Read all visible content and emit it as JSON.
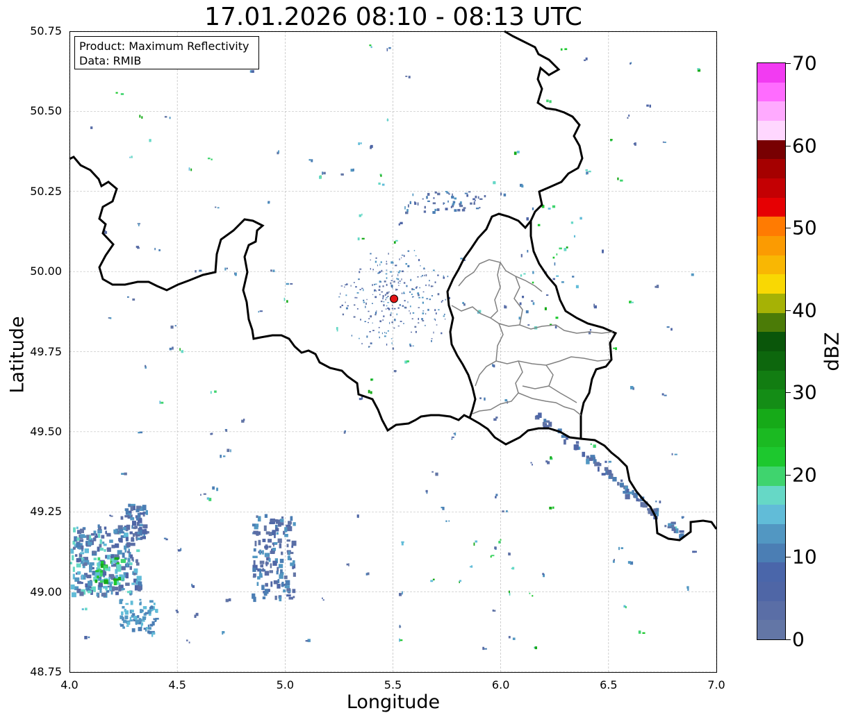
{
  "title": "17.01.2026 08:10 - 08:13 UTC",
  "info": {
    "product": "Product: Maximum Reflectivity",
    "data": "Data: RMIB"
  },
  "axes": {
    "xlabel": "Longitude",
    "ylabel": "Latitude",
    "xlim": [
      4.0,
      7.0
    ],
    "ylim": [
      48.75,
      50.75
    ],
    "x_ticks": [
      "4.0",
      "4.5",
      "5.0",
      "5.5",
      "6.0",
      "6.5",
      "7.0"
    ],
    "y_ticks": [
      "48.75",
      "49.00",
      "49.25",
      "49.50",
      "49.75",
      "50.00",
      "50.25",
      "50.50",
      "50.75"
    ],
    "grid": true
  },
  "colorbar": {
    "label": "dBZ",
    "ticks": [
      "0",
      "10",
      "20",
      "30",
      "40",
      "50",
      "60",
      "70"
    ],
    "range": [
      0,
      70
    ],
    "colors": [
      "#6376a6",
      "#5a6ea6",
      "#4f66a6",
      "#4a66aa",
      "#4b7eb4",
      "#5297c2",
      "#61bcd8",
      "#66d8c6",
      "#3fd46e",
      "#1dc82e",
      "#1bba22",
      "#16aa18",
      "#148d16",
      "#127d12",
      "#0d670d",
      "#0a560a",
      "#4b7b07",
      "#a6b205",
      "#f9d803",
      "#f9b703",
      "#fb9b02",
      "#ff7b02",
      "#e60003",
      "#c40003",
      "#a50000",
      "#780002",
      "#ffd7ff",
      "#ffaaff",
      "#ff6cff",
      "#f23bf2"
    ]
  },
  "radar_site": {
    "lon": 5.505,
    "lat": 49.915,
    "color": "#e41515"
  },
  "map_features": {
    "borders": "thick black national borders (Belgium / France / Luxembourg / Germany)",
    "districts": "grey cantonal boundaries in Luxembourg"
  }
}
